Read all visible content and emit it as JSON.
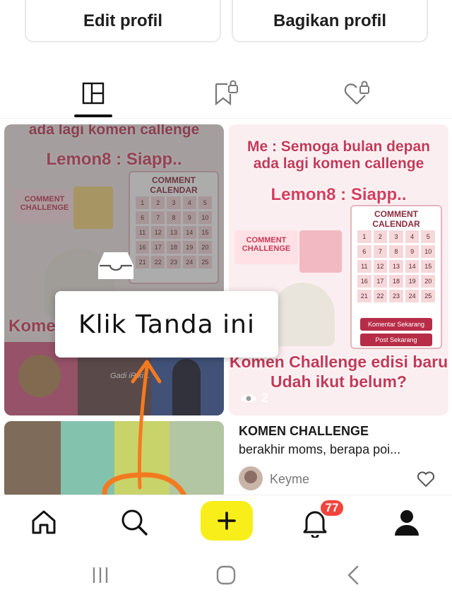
{
  "profile": {
    "edit_label": "Edit profil",
    "share_label": "Bagikan profil"
  },
  "tabs": [
    {
      "icon": "grid-icon",
      "active": true
    },
    {
      "icon": "bookmark-lock-icon",
      "active": false
    },
    {
      "icon": "heart-lock-icon",
      "active": false
    }
  ],
  "feed": {
    "card1": {
      "heading": "ada lagi komen callenge",
      "lemon": "Lemon8 : Siapp..",
      "calendar_title": "COMMENT CALENDAR",
      "badge": "COMMENT CHALLENGE",
      "komen": "Komen",
      "gadi": "Gadi iRiki..."
    },
    "card2": {
      "heading_line1": "Me : Semoga bulan depan",
      "heading_line2": "ada lagi komen callenge",
      "lemon": "Lemon8 : Siapp..",
      "calendar_title": "COMMENT CALENDAR",
      "badge": "COMMENT CHALLENGE",
      "cal_btn1": "Komentar Sekarang",
      "cal_btn2": "Post Sekarang",
      "challenge_line1": "Komen Challenge edisi baru",
      "challenge_line2": "Udah ikut belum?",
      "views": "2"
    },
    "post": {
      "title": "KOMEN CHALLENGE",
      "subtitle": "berakhir moms, berapa poi...",
      "author": "Keyme"
    }
  },
  "annotation": {
    "tooltip": "Klik Tanda ini",
    "color": "#f47a20"
  },
  "bottom_nav": {
    "notif_count": "77",
    "create_color": "#f7ee1a"
  }
}
